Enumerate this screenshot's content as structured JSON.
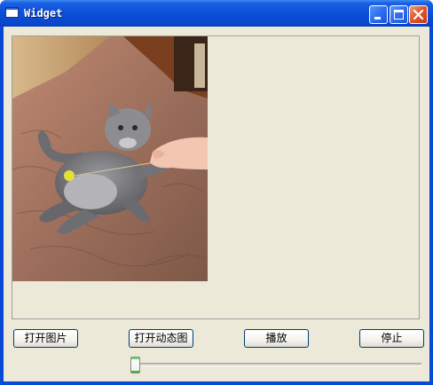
{
  "window": {
    "title": "Widget",
    "colors": {
      "titlebar": "#0a4fd8",
      "client_bg": "#ece9d8",
      "close_button": "#e1582e"
    }
  },
  "title_buttons": {
    "minimize_icon": "minimize-icon",
    "maximize_icon": "maximize-icon",
    "close_icon": "close-icon"
  },
  "image_panel": {
    "content": "cat-photo"
  },
  "buttons": {
    "open_image": "打开图片",
    "open_gif": "打开动态图",
    "play": "播放",
    "stop": "停止"
  },
  "slider": {
    "value": 0.0
  }
}
